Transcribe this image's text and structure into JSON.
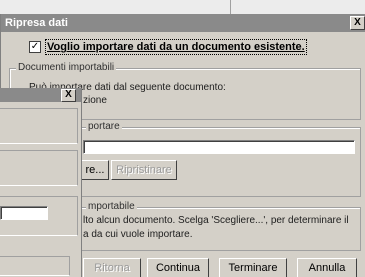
{
  "dialog": {
    "title": "Ripresa dati",
    "close_glyph": "X",
    "checkbox": {
      "checked_glyph": "✓",
      "label": "Voglio importare dati da un documento esistente."
    },
    "groups": {
      "importable": {
        "legend": "Documenti importabili",
        "line1": "Può importare dati dal seguente documento:",
        "line2": "zione"
      },
      "import": {
        "legend": "portare",
        "choose_btn": "re...",
        "restore_btn": "Ripristinare"
      },
      "not_importable": {
        "legend": "mportabile",
        "line1": "lto alcun documento. Scelga 'Scegliere...', per determinare il",
        "line2": "a da cui vuole importare."
      }
    },
    "footer": {
      "back": "Ritorna",
      "continue": "Continua",
      "finish": "Terminare",
      "cancel": "Annulla"
    }
  },
  "overlay": {
    "close_glyph": "X"
  }
}
